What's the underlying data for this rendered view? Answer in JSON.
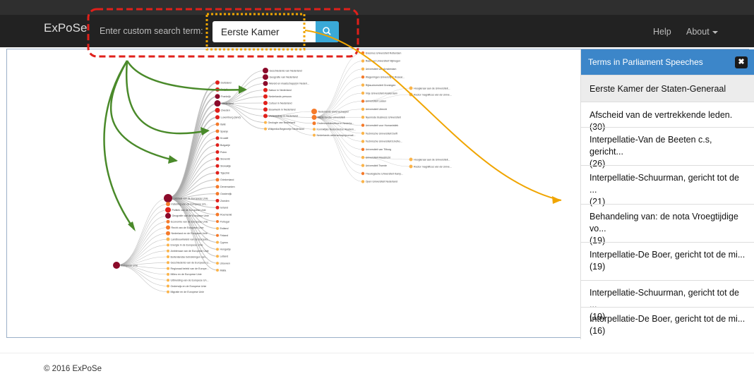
{
  "navbar": {
    "brand": "ExPoSe",
    "search_label": "Enter custom search term:",
    "search_value": "Eerste Kamer",
    "help": "Help",
    "about": "About"
  },
  "panel": {
    "title": "Terms in Parliament Speeches",
    "close": "✖",
    "items": [
      "Eerste Kamer der Staten-Generaal",
      "Afscheid van de vertrekkende leden. (30)",
      "Interpellatie-Van de Beeten c.s, gericht...",
      "(26)",
      "Interpellatie-Schuurman, gericht tot de ...",
      "(21)",
      "Behandeling van: de nota Vroegtijdige vo...",
      "(19)",
      "Interpellatie-De Boer, gericht tot de mi...",
      "(19)",
      "Interpellatie-Schuurman, gericht tot de ...",
      "(19)",
      "Interpellatie-De Boer, gericht tot de mi...",
      "(16)"
    ]
  },
  "graph": {
    "root": "Europese Unie",
    "level1": [
      "Lidstaat van de Europese Unie",
      "Instelling van de Europese Uni...",
      "Politiek van de Europese Unie",
      "Geografie van de Europese Unie",
      "Economie van de Europese Unie",
      "Recht van de Europese Unie",
      "Nederland en de Europese Unie",
      "Landbouwbeleid van de Europes...",
      "Energie in de Europese Unie",
      "Ambtenaar van de Europese Unie",
      "Buitenlandse betrekkingen van...",
      "Geschiedenis van de Europese U...",
      "Regionaal beleid van de Europe...",
      "Milieu en de Europese Unie",
      "Uitbreiding van de Europese Un...",
      "Onderwijs en de Europese Unie",
      "Migratie en de Europese Unie"
    ],
    "level2": [
      "Duitsland",
      "België",
      "Frankrijk",
      "Nederland",
      "Zweden",
      "Luxemburg (land)",
      "Italië",
      "Spanje",
      "Kroatië",
      "Bulgarije",
      "Polen",
      "Slovenië",
      "Slowakije",
      "Tsjechië",
      "Griekenland",
      "Denemarken",
      "Oostenrijk",
      "Zweden",
      "Ierland",
      "Roemenië",
      "Portugal",
      "Estland",
      "Finland",
      "Cyprus",
      "Hongarije",
      "Letland",
      "Litouwen",
      "Malta"
    ],
    "level3": [
      "Geschiedenis van Nederland",
      "Geografie van Nederland",
      "Wereld en maatschappij in Nederl...",
      "Natuur in Nederland",
      "Nederlands persoon",
      "Cultuur in Nederland",
      "Bouwwerk in Nederland",
      "Wetenschap in Nederland",
      "Geologie van Nederland",
      "Wikipedia:Beginnetje Nederland"
    ],
    "level4": [
      "Nederlands wetenschapper",
      "Nederlandse universiteit",
      "Onderzoeksinstituut in Nederla...",
      "Koninklijke Nederlandse Akadem...",
      "Nederlands wetenschapsjournali..."
    ],
    "level5": [
      "Erasmus Universiteit Rotterdam",
      "Radboud Universiteit Nijmegen",
      "Universiteit van Amsterdam",
      "Wageningen University & Resear...",
      "Rijksuniversiteit Groningen",
      "Vrije Universiteit Amsterdam",
      "Universiteit Leiden",
      "Universiteit Utrecht",
      "Nyenrode Business Universiteit",
      "Universiteit voor Humanistiek",
      "Technische Universiteit Delft",
      "Technische Universiteit Eindho...",
      "Universiteit van Tilburg",
      "Universiteit Maastricht",
      "Universiteit Twente",
      "Theologische Universiteit Kamp...",
      "Open Universiteit Nederland"
    ],
    "level6": [
      "Hoogleraar aan de Universiteit...",
      "Rector magnificus van de Unive...",
      "Hoogleraar aan de Universiteit...",
      "Rector magnificus van de Unive..."
    ]
  },
  "colors": {
    "navbar": "#222222",
    "accent": "#3aa9d8",
    "panel_header": "#3c86c9",
    "annotation_red": "#e0201b",
    "annotation_orange": "#f0a500",
    "annotation_green": "#4a8a2a",
    "node_dark": "#8b0a2a",
    "node_red": "#e0201b",
    "node_orange": "#f57a2a",
    "node_light": "#fbb44a"
  },
  "icons": {
    "search": "search-icon",
    "close": "close-icon"
  },
  "footer": {
    "copyright": "© 2016 ExPoSe"
  }
}
